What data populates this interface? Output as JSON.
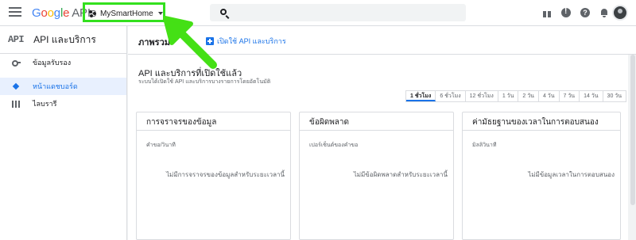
{
  "header": {
    "logo_parts": [
      "G",
      "o",
      "o",
      "g",
      "l",
      "e"
    ],
    "logo_suffix": "APIs",
    "project_name": "MySmartHome",
    "search_placeholder": "",
    "help_glyph": "?"
  },
  "sidebar": {
    "api_mark": "API",
    "title": "API และบริการ",
    "items": [
      {
        "label": "หน้าแดชบอร์ด",
        "icon": "dashboard-icon",
        "active": true
      },
      {
        "label": "ไลบรารี",
        "icon": "library-icon",
        "active": false
      },
      {
        "label": "ข้อมูลรับรอง",
        "icon": "key-icon",
        "active": false
      }
    ]
  },
  "main": {
    "title": "ภาพรวม",
    "enable_button": "เปิดใช้ API และบริการ",
    "panel_title": "API และบริการที่เปิดใช้แล้ว",
    "panel_subtitle": "ระบบได้เปิดใช้ API และบริการบางรายการโดยอัตโนมัติ",
    "time_ranges": [
      "1 ชั่วโมง",
      "6 ชั่วโมง",
      "12 ชั่วโมง",
      "1 วัน",
      "2 วัน",
      "4 วัน",
      "7 วัน",
      "14 วัน",
      "30 วัน"
    ],
    "selected_range": "1 ชั่วโมง",
    "cards": [
      {
        "title": "การจราจรของข้อมูล",
        "unit": "คำขอ/วินาที",
        "empty": "ไม่มีการจราจรของข้อมูลสำหรับระยะเวลานี้"
      },
      {
        "title": "ข้อผิดพลาด",
        "unit": "เปอร์เซ็นต์ของคำขอ",
        "empty": "ไม่มีข้อผิดพลาดสำหรับระยะเวลานี้"
      },
      {
        "title": "ค่ามัธยฐานของเวลาในการตอบสนอง",
        "unit": "มิลลิวินาที",
        "empty": "ไม่มีข้อมูลเวลาในการตอบสนอง"
      }
    ]
  },
  "colors": {
    "accent": "#1a73e8",
    "highlight": "#33e01e",
    "arrow": "#44e015"
  }
}
